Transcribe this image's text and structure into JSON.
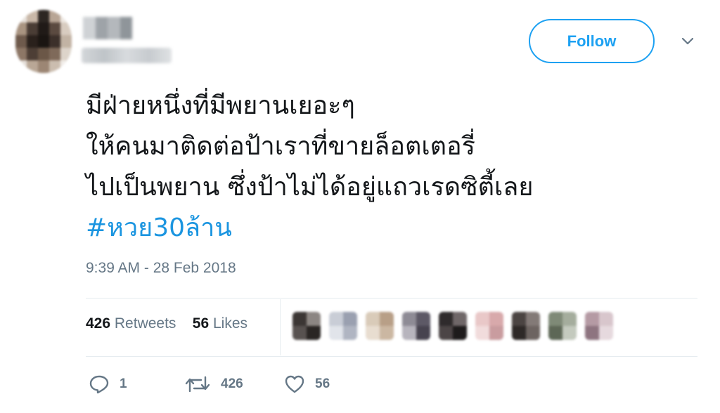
{
  "tweet": {
    "follow_label": "Follow",
    "text_lines": [
      "มีฝ่ายหนึ่งที่มีพยานเยอะๆ",
      "ให้คนมาติดต่อป้าเราที่ขายล็อตเตอรี่",
      "ไปเป็นพยาน ซึ่งป้าไม่ได้อยู่แถวเรดซิตี้เลย"
    ],
    "hashtag": "#หวย30ล้าน",
    "timestamp": "9:39 AM - 28 Feb 2018",
    "retweets_count": "426",
    "retweets_label": "Retweets",
    "likes_count": "56",
    "likes_label": "Likes",
    "actions": {
      "reply_count": "1",
      "retweet_count": "426",
      "like_count": "56"
    }
  },
  "icons": {
    "reply": "reply-icon",
    "retweet": "retweet-icon",
    "like": "heart-icon",
    "chevron": "chevron-down-icon"
  },
  "colors": {
    "accent": "#1da1f2",
    "hashtag": "#1b95e0",
    "muted": "#657786",
    "text": "#14171a"
  }
}
